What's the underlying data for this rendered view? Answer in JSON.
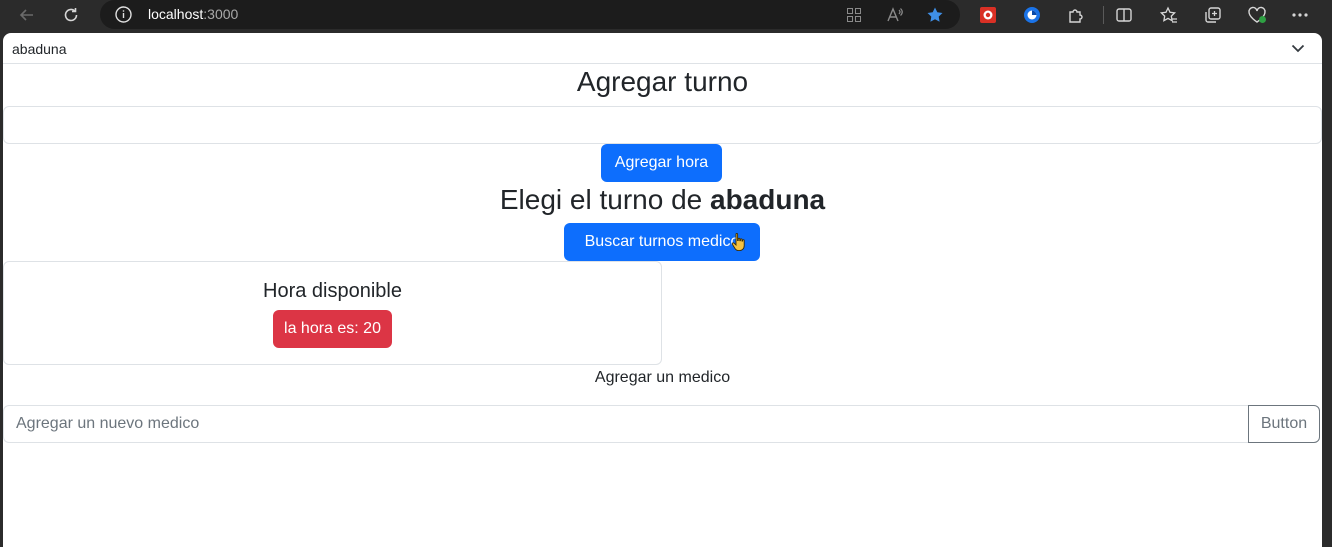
{
  "browser": {
    "url_host": "localhost",
    "url_port": ":3000",
    "icons": [
      "back-icon",
      "refresh-icon",
      "info-icon",
      "grid-icon",
      "read-aloud-icon",
      "favorite-star-icon",
      "extension-red-icon",
      "extension-blue-icon",
      "extensions-icon",
      "split-screen-icon",
      "favorites-icon",
      "collections-icon",
      "browser-essentials-icon",
      "more-icon"
    ]
  },
  "page": {
    "select_value": "abaduna",
    "title_add": "Agregar turno",
    "add_hour_button": "Agregar hora",
    "choose_prefix": "Elegi el turno de ",
    "choose_name": "abaduna",
    "search_button": "Buscar turnos medico",
    "card_title": "Hora disponible",
    "hour_badge": "la hora es: 20",
    "add_doctor_label": "Agregar un medico",
    "doctor_input_placeholder": "Agregar un nuevo medico",
    "doctor_button": "Button"
  },
  "colors": {
    "primary": "#0d6efd",
    "danger": "#dc3545",
    "chrome_bg": "#2b2b2b"
  }
}
